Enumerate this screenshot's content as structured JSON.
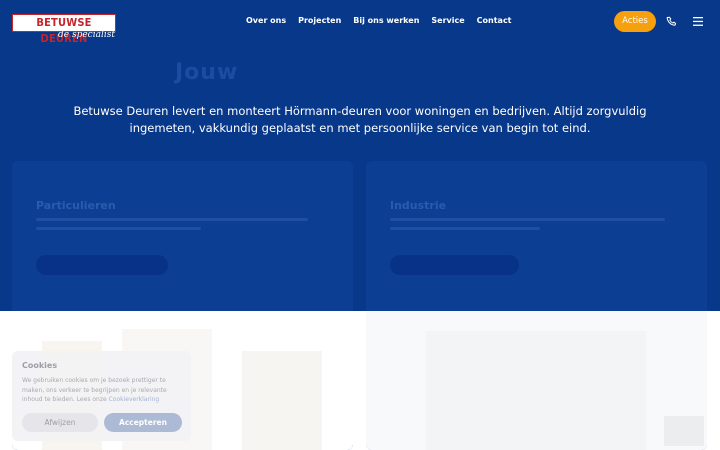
{
  "brand": {
    "name": "BETUWSE DEUREN",
    "tagline": "de specialist"
  },
  "nav": {
    "items": [
      {
        "label": "Over ons"
      },
      {
        "label": "Projecten"
      },
      {
        "label": "Bij ons werken"
      },
      {
        "label": "Service"
      },
      {
        "label": "Contact"
      }
    ],
    "cta_label": "Acties",
    "phone_icon": "phone-icon",
    "menu_icon": "hamburger-icon"
  },
  "hero": {
    "ghost_title": "Jouw",
    "intro": "Betuwse Deuren levert en monteert Hörmann-deuren voor woningen en bedrijven. Altijd zorgvuldig ingemeten, vakkundig geplaatst en met persoonlijke service van begin tot eind."
  },
  "cards": [
    {
      "title": "Particulieren"
    },
    {
      "title": "Industrie"
    }
  ],
  "cookie": {
    "title": "Cookies",
    "text": "We gebruiken cookies om je bezoek prettiger te maken, ons verkeer te begrijpen en je relevante inhoud te bieden. Lees onze",
    "link": "Cookieverklaring",
    "reject_label": "Afwijzen",
    "accept_label": "Accepteren"
  },
  "colors": {
    "hero_bg": "#08388a",
    "accent": "#f5a00c",
    "brand_red": "#c6232b"
  }
}
